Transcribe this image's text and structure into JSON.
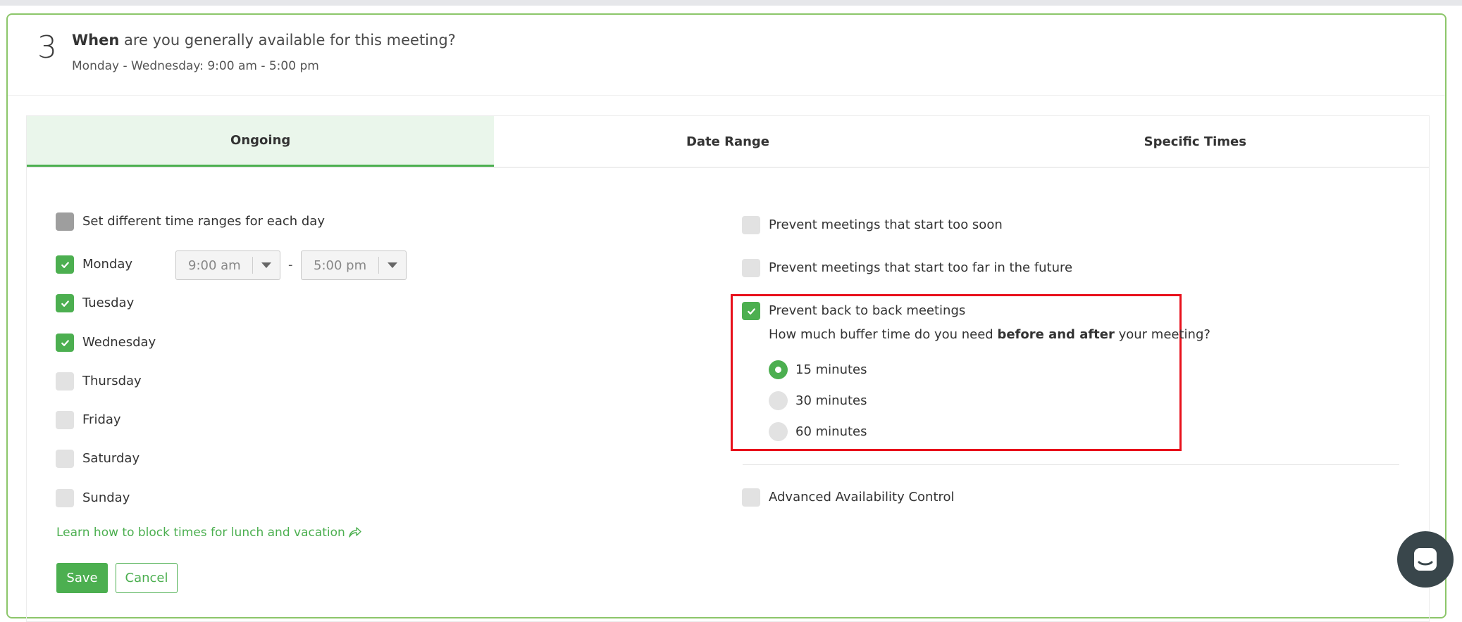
{
  "step": {
    "number": "3",
    "title_bold": "When",
    "title_rest": " are you generally available for this meeting?",
    "subtitle": "Monday - Wednesday: 9:00 am - 5:00 pm"
  },
  "tabs": [
    {
      "label": "Ongoing",
      "active": true
    },
    {
      "label": "Date Range",
      "active": false
    },
    {
      "label": "Specific Times",
      "active": false
    }
  ],
  "left": {
    "different_ranges_label": "Set different time ranges for each day",
    "days": [
      {
        "label": "Monday",
        "checked": true
      },
      {
        "label": "Tuesday",
        "checked": true
      },
      {
        "label": "Wednesday",
        "checked": true
      },
      {
        "label": "Thursday",
        "checked": false
      },
      {
        "label": "Friday",
        "checked": false
      },
      {
        "label": "Saturday",
        "checked": false
      },
      {
        "label": "Sunday",
        "checked": false
      }
    ],
    "start_time": "9:00 am",
    "range_separator": "-",
    "end_time": "5:00 pm",
    "learn_link": "Learn how to block times for lunch and vacation",
    "save_label": "Save",
    "cancel_label": "Cancel"
  },
  "right": {
    "too_soon_label": "Prevent meetings that start too soon",
    "too_far_label": "Prevent meetings that start too far in the future",
    "back_to_back_label": "Prevent back to back meetings",
    "buffer_q_prefix": "How much buffer time do you need ",
    "buffer_q_bold": "before and after",
    "buffer_q_suffix": " your meeting?",
    "buffer_options": [
      {
        "label": "15 minutes",
        "selected": true
      },
      {
        "label": "30 minutes",
        "selected": false
      },
      {
        "label": "60 minutes",
        "selected": false
      }
    ],
    "advanced_label": "Advanced Availability Control"
  },
  "colors": {
    "accent": "#4caf50",
    "highlight": "#e8101b",
    "tab_active_bg": "#eaf6eb"
  }
}
